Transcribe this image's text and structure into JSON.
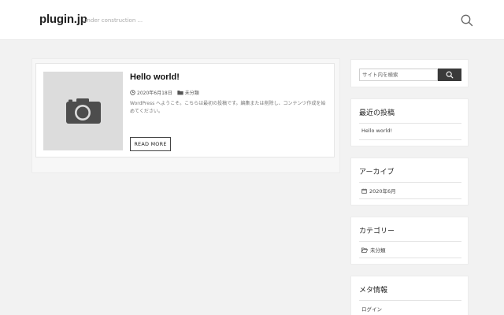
{
  "header": {
    "site_title": "plugin.jp",
    "tagline": "under construction ...",
    "search_icon": "search-icon"
  },
  "post": {
    "title": "Hello world!",
    "date": "2020年6月18日",
    "category": "未分類",
    "excerpt": "WordPress へようこそ。こちらは最初の投稿です。編集または削除し、コンテンツ作成を始めてください。",
    "read_more": "READ MORE",
    "thumbnail_icon": "camera-icon"
  },
  "sidebar": {
    "search": {
      "placeholder": "サイト内を検索",
      "button_icon": "search-icon"
    },
    "recent": {
      "title": "最近の投稿",
      "items": [
        "Hello world!"
      ]
    },
    "archives": {
      "title": "アーカイブ",
      "items": [
        "2020年6月"
      ]
    },
    "categories": {
      "title": "カテゴリー",
      "items": [
        "未分類"
      ]
    },
    "meta": {
      "title": "メタ情報",
      "items": [
        "ログイン"
      ]
    }
  }
}
